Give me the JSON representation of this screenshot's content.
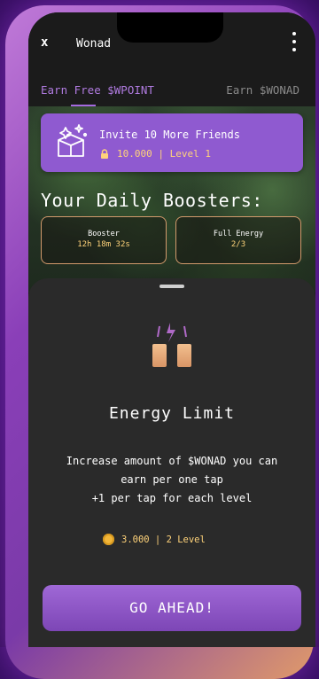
{
  "header": {
    "close_label": "x",
    "app_title": "Wonad"
  },
  "tabs": [
    {
      "label": "Earn Free $WPOINT",
      "active": true
    },
    {
      "label": "Earn $WONAD",
      "active": false
    }
  ],
  "invite_card": {
    "title": "Invite 10 More Friends",
    "meta": "10.000 | Level 1",
    "icons": [
      "gift-box-icon",
      "lock-icon"
    ]
  },
  "boosters": {
    "section_title": "Your Daily Boosters:",
    "items": [
      {
        "name": "Booster",
        "value": "12h 18m 32s"
      },
      {
        "name": "Full Energy",
        "value": "2/3"
      }
    ]
  },
  "sheet": {
    "title": "Energy Limit",
    "description_lines": [
      "Increase amount of $WONAD you can",
      "earn per one tap",
      "+1 per tap for each level"
    ],
    "price": "3.000 | 2 Level",
    "cta_label": "GO AHEAD!"
  },
  "colors": {
    "accent": "#8f5ad0",
    "gold": "#ffd37a",
    "sheet_bg": "#2a2a2a",
    "tab_active": "#b07be0"
  }
}
